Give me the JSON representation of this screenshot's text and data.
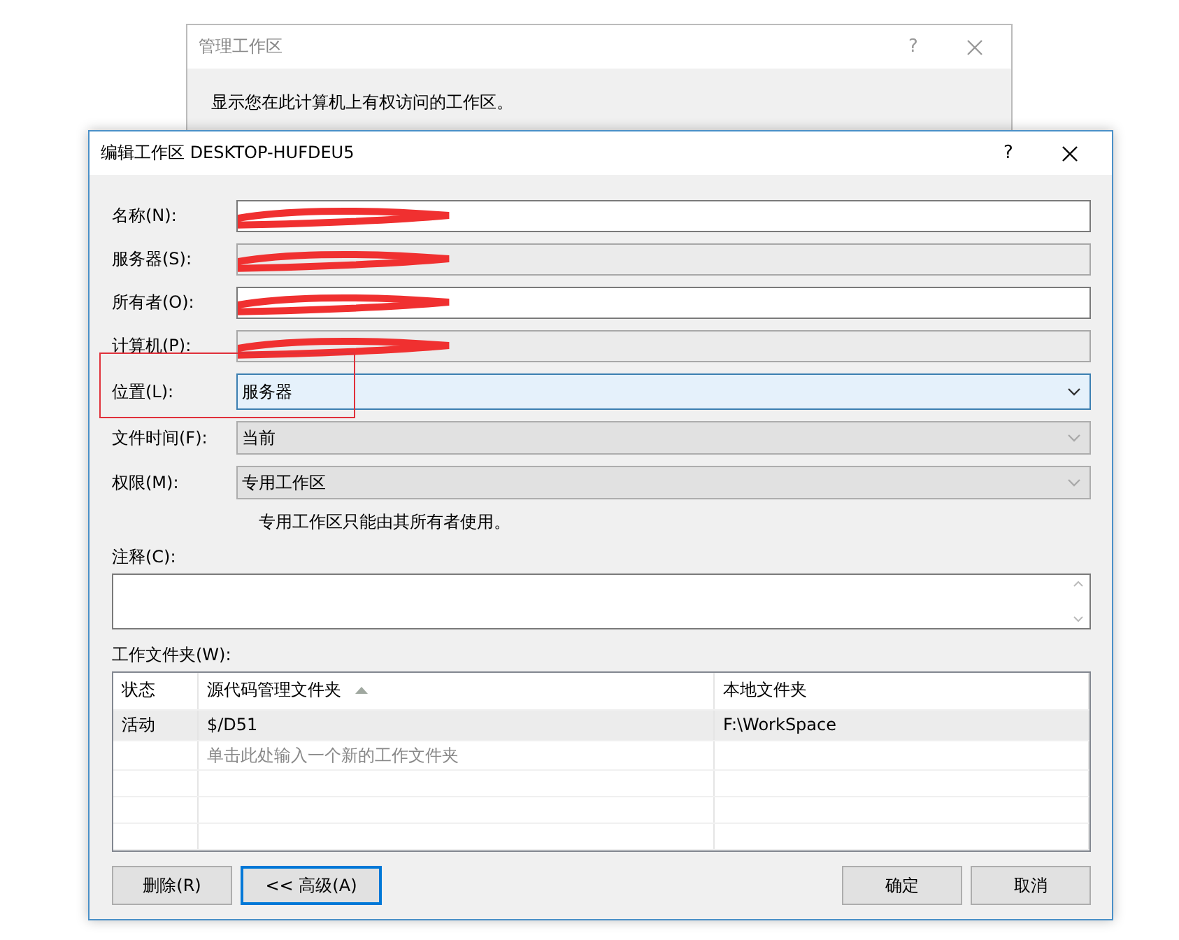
{
  "back_window": {
    "title": "管理工作区",
    "description": "显示您在此计算机上有权访问的工作区。"
  },
  "window": {
    "title": "编辑工作区 DESKTOP-HUFDEU5",
    "help": "?"
  },
  "fields": [
    {
      "label": "名称(N):",
      "kind": "text",
      "readonly": false,
      "redacted": true
    },
    {
      "label": "服务器(S):",
      "kind": "text",
      "readonly": true,
      "redacted": true
    },
    {
      "label": "所有者(O):",
      "kind": "text",
      "readonly": false,
      "redacted": true
    },
    {
      "label": "计算机(P):",
      "kind": "text",
      "readonly": true,
      "redacted": true
    },
    {
      "label": "位置(L):",
      "kind": "combo",
      "value": "服务器",
      "disabled": false,
      "focused": true,
      "highlighted": true
    },
    {
      "label": "文件时间(F):",
      "kind": "combo",
      "value": "当前",
      "disabled": true,
      "focused": false,
      "highlighted": false
    },
    {
      "label": "权限(M):",
      "kind": "combo",
      "value": "专用工作区",
      "disabled": true,
      "focused": false,
      "highlighted": false
    }
  ],
  "permission_hint": "专用工作区只能由其所有者使用。",
  "comment": {
    "label": "注释(C):"
  },
  "folders": {
    "label": "工作文件夹(W):",
    "columns": [
      {
        "title": "状态",
        "sorted": false
      },
      {
        "title": "源代码管理文件夹",
        "sorted": true
      },
      {
        "title": "本地文件夹",
        "sorted": false
      }
    ],
    "rows": [
      {
        "kind": "mapping",
        "status": "活动",
        "source": "$/D51",
        "local": "F:\\WorkSpace",
        "selected": true
      },
      {
        "kind": "new",
        "placeholder": "单击此处输入一个新的工作文件夹",
        "selected": false
      }
    ]
  },
  "buttons_left": [
    {
      "label": "删除(R)",
      "focused": false
    },
    {
      "label": "<< 高级(A)",
      "focused": true
    }
  ],
  "buttons_right": [
    {
      "label": "确定",
      "focused": false
    },
    {
      "label": "取消",
      "focused": false
    }
  ]
}
